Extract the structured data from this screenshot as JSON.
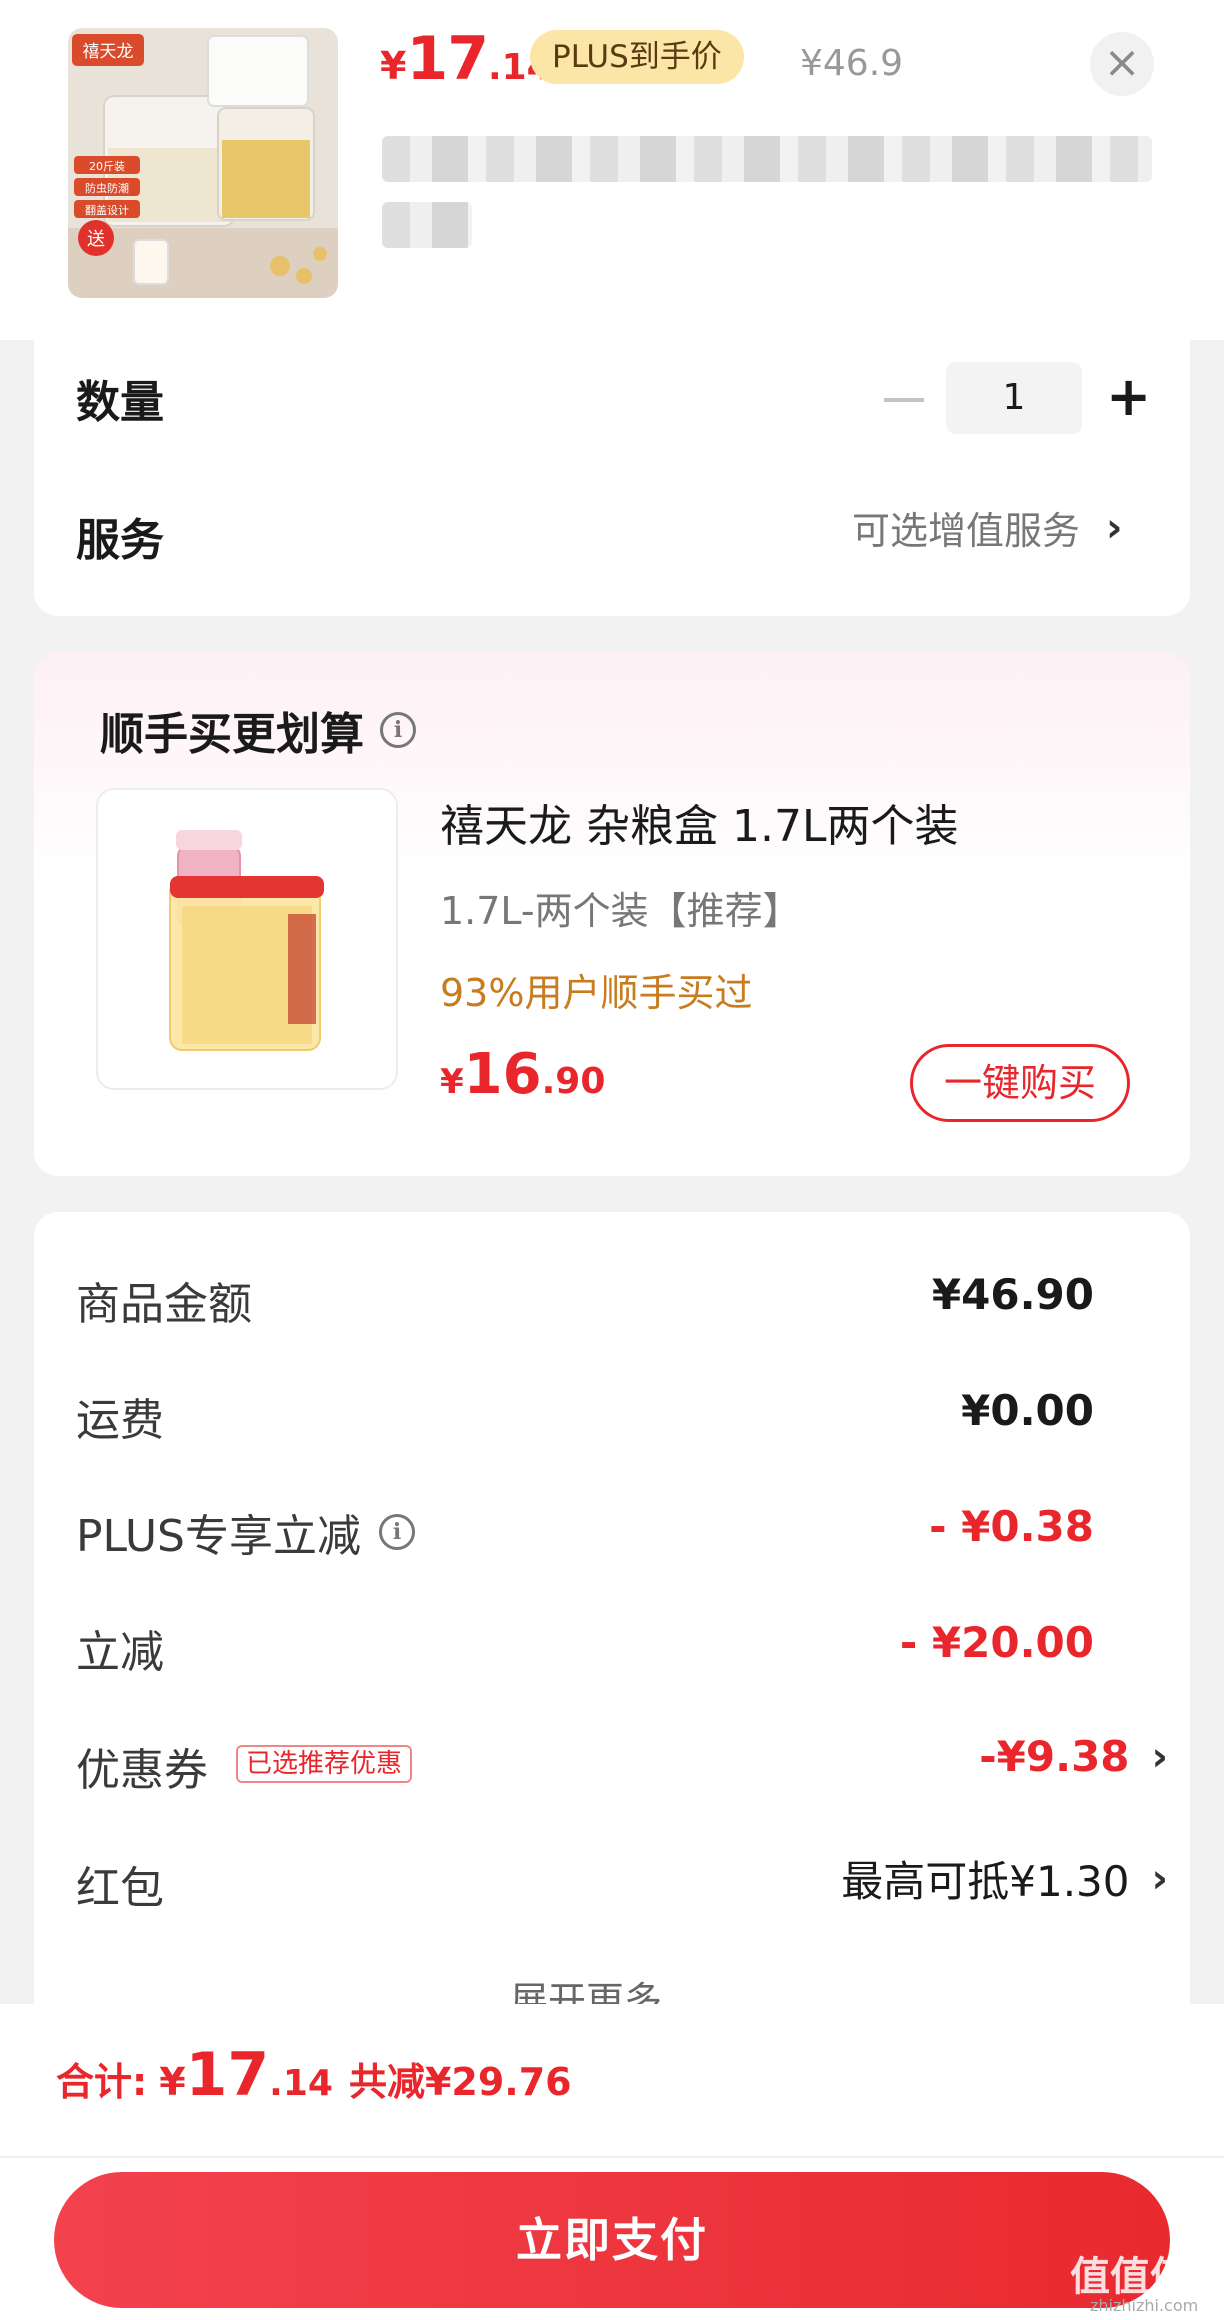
{
  "header": {
    "price_symbol": "¥",
    "price_int": "17",
    "price_dec": ".14",
    "plus_tag": "PLUS到手价",
    "original_price": "¥46.9",
    "close_icon": "close-icon",
    "thumb_brand": "禧天龙",
    "thumb_badges": [
      "20斤装",
      "防虫防潮",
      "翻盖设计"
    ],
    "thumb_gift": "送"
  },
  "options": {
    "quantity_label": "数量",
    "quantity_value": "1",
    "minus_icon": "minus-icon",
    "plus_icon": "plus-icon",
    "service_label": "服务",
    "service_value": "可选增值服务",
    "chevron": "›"
  },
  "addon": {
    "title": "顺手买更划算",
    "info_icon": "info-icon",
    "product_title": "禧天龙 杂粮盒 1.7L两个装",
    "spec": "1.7L-两个装【推荐】",
    "popularity": "93%用户顺手买过",
    "price_symbol": "¥",
    "price_int": "16",
    "price_dec": ".90",
    "buy_label": "一键购买"
  },
  "summary": {
    "rows": [
      {
        "label": "商品金额",
        "value": "¥46.90"
      },
      {
        "label": "运费",
        "value": "¥0.00"
      },
      {
        "label": "PLUS专享立减",
        "value": "- ¥0.38"
      },
      {
        "label": "立减",
        "value": "- ¥20.00"
      },
      {
        "label": "优惠券",
        "value": "-¥9.38",
        "tag": "已选推荐优惠"
      },
      {
        "label": "红包",
        "value": "最高可抵¥1.30"
      }
    ],
    "expand_label": "展开更多"
  },
  "footer": {
    "total_label": "合计:",
    "total_symbol": "¥",
    "total_int": "17",
    "total_dec": ".14",
    "save_text": "共减¥29.76",
    "pay_label": "立即支付",
    "watermark": "值值值",
    "watermark_url": "zhizhizhi.com"
  },
  "colors": {
    "accent_red": "#e8262b",
    "plus_gold": "#fbe6a8",
    "popularity_orange": "#c87c1e"
  }
}
